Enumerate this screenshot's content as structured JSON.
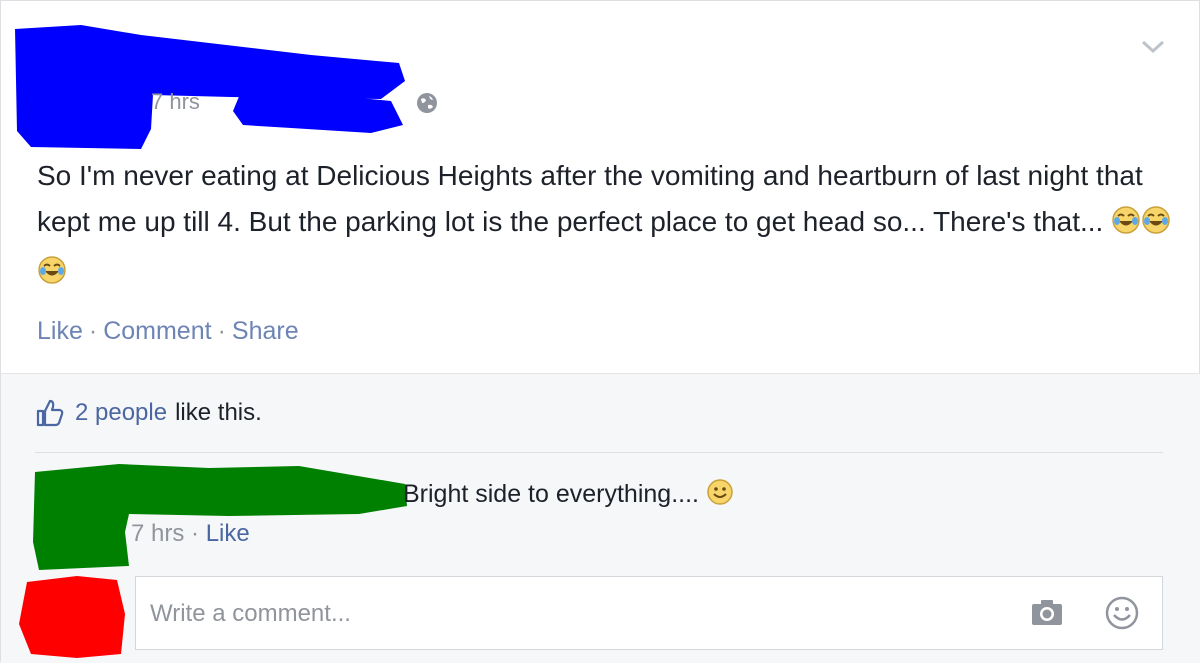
{
  "post": {
    "timestamp": "7 hrs",
    "text_main": "So I'm never eating at Delicious Heights after the vomiting and heartburn of last night that kept me up till 4. But the parking lot is the perfect place to get head so... There's that...",
    "emoji": [
      "face-with-tears-of-joy-icon",
      "face-with-tears-of-joy-icon",
      "face-with-tears-of-joy-icon"
    ],
    "actions": {
      "like": "Like",
      "comment": "Comment",
      "share": "Share",
      "separator": "·"
    }
  },
  "ufi": {
    "likes_count_text": "2 people",
    "likes_suffix": "like this.",
    "comment": {
      "text": "Bright side to everything....",
      "emoji": "smiley-icon",
      "timestamp": "7 hrs",
      "separator": "·",
      "like": "Like"
    },
    "composer": {
      "placeholder": "Write a comment...",
      "icons": [
        "camera-icon",
        "smiley-icon"
      ]
    }
  },
  "colors": {
    "link": "#4b67a1",
    "meta": "#90949c",
    "redaction_blue": "#0000ff",
    "redaction_green": "#008000",
    "redaction_red": "#ff0000"
  }
}
